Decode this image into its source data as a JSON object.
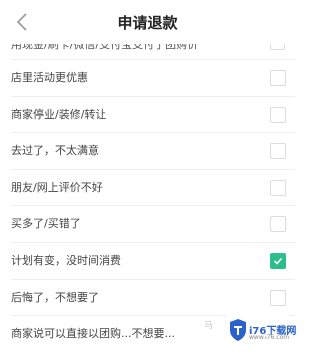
{
  "header": {
    "title": "申请退款"
  },
  "partial_row": {
    "label": "用现金/刷卡/微信/支付宝支付了团购价"
  },
  "reasons": [
    {
      "label": "店里活动更优惠",
      "checked": false
    },
    {
      "label": "商家停业/装修/转让",
      "checked": false
    },
    {
      "label": "去过了，不太满意",
      "checked": false
    },
    {
      "label": "朋友/网上评价不好",
      "checked": false
    },
    {
      "label": "买多了/买错了",
      "checked": false
    },
    {
      "label": "计划有变，没时间消费",
      "checked": true
    },
    {
      "label": "后悔了，不想要了",
      "checked": false
    },
    {
      "label": "商家说可以直接以团购...不想要...",
      "checked": false
    }
  ],
  "watermark": {
    "text": "马",
    "brand": "i76下载网",
    "site": "www.i76.com"
  },
  "colors": {
    "accent": "#2cbf8c",
    "brand": "#2a62c9"
  }
}
